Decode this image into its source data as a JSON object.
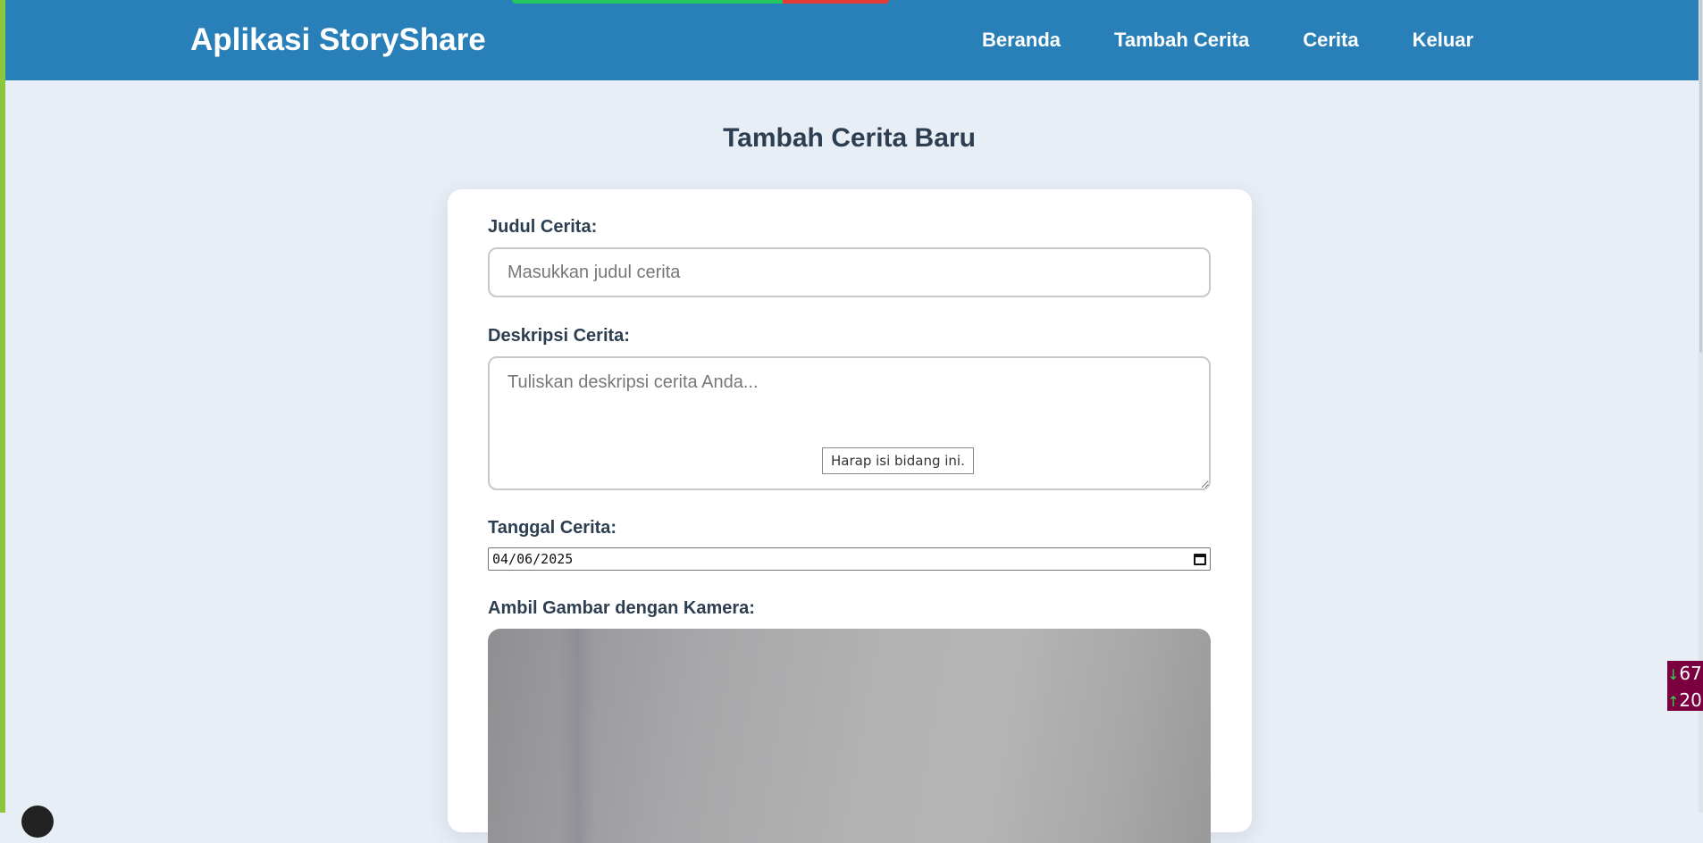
{
  "navbar": {
    "brand": "Aplikasi StoryShare",
    "links": [
      "Beranda",
      "Tambah Cerita",
      "Cerita",
      "Keluar"
    ]
  },
  "page": {
    "title": "Tambah Cerita Baru"
  },
  "form": {
    "title_label": "Judul Cerita:",
    "title_placeholder": "Masukkan judul cerita",
    "description_label": "Deskripsi Cerita:",
    "description_placeholder": "Tuliskan deskripsi cerita Anda...",
    "validation_tooltip": "Harap isi bidang ini.",
    "date_label": "Tanggal Cerita:",
    "date_value": "04/06/2025",
    "camera_label": "Ambil Gambar dengan Kamera:"
  },
  "overlay": {
    "download_speed": "67",
    "upload_speed": "20"
  },
  "colors": {
    "navbar": "#2980b9",
    "background": "#e8eef6",
    "text_dark": "#2c3e50"
  }
}
